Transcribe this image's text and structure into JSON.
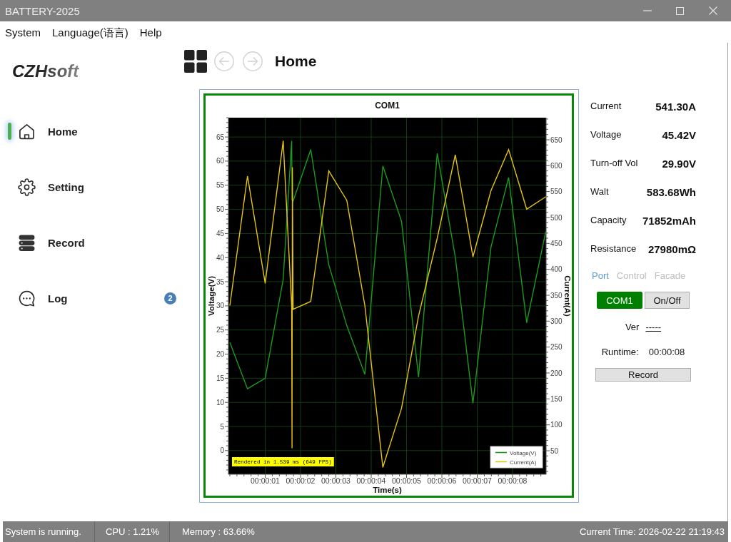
{
  "window": {
    "title": "BATTERY-2025"
  },
  "menu": [
    "System",
    "Language(语言)",
    "Help"
  ],
  "sidebar": {
    "logo": "CZHsoft",
    "items": [
      {
        "label": "Home",
        "selected": true
      },
      {
        "label": "Setting",
        "selected": false
      },
      {
        "label": "Record",
        "selected": false
      },
      {
        "label": "Log",
        "selected": false,
        "badge": "2"
      }
    ]
  },
  "header": {
    "title": "Home"
  },
  "chart_panel": {
    "render_info": "Rendered in 1.539 ms (649 FPS)",
    "chart_data": {
      "type": "line",
      "title": "COM1",
      "xlabel": "Time(s)",
      "ylabel": "Voltage(V)",
      "y2label": "Current(A)",
      "x": [
        0,
        0.5,
        1.0,
        1.51,
        1.75,
        1.76,
        1.77,
        1.79,
        2.29,
        2.8,
        3.31,
        3.82,
        4.33,
        4.86,
        5.34,
        5.87,
        6.38,
        6.88,
        7.39,
        7.89,
        8.4,
        8.94
      ],
      "series": [
        {
          "name": "Voltage(V)",
          "color": "#1c9a1c",
          "values": [
            22.4,
            12.8,
            15.0,
            35.5,
            64.2,
            52.0,
            51.9,
            51.7,
            62.4,
            38.5,
            25.9,
            15.8,
            59.0,
            47.5,
            15.2,
            61.6,
            40.1,
            9.8,
            42.2,
            56.6,
            26.5,
            45.4
          ]
        },
        {
          "name": "Current(A)",
          "color": "#e6c312",
          "axis": "y2",
          "values": [
            330,
            580,
            373,
            648,
            328,
            55,
            597,
            323,
            338,
            590,
            533,
            330,
            18,
            132,
            310,
            460,
            621,
            424,
            552,
            631,
            516,
            540
          ]
        }
      ],
      "xlim": [
        -0.04,
        8.95
      ],
      "ylim": [
        -4.9,
        69
      ],
      "y2lim": [
        4.6,
        692.6
      ],
      "xticks": [
        {
          "value": 1,
          "label": "00:00:01"
        },
        {
          "value": 2,
          "label": "00:00:02"
        },
        {
          "value": 3,
          "label": "00:00:03"
        },
        {
          "value": 4,
          "label": "00:00:04"
        },
        {
          "value": 5,
          "label": "00:00:05"
        },
        {
          "value": 6,
          "label": "00:00:06"
        },
        {
          "value": 7,
          "label": "00:00:07"
        },
        {
          "value": 8,
          "label": "00:00:08"
        }
      ],
      "yticks": [
        0,
        5,
        10,
        15,
        20,
        25,
        30,
        35,
        40,
        45,
        50,
        55,
        60,
        65
      ],
      "y2ticks": [
        50,
        100,
        150,
        200,
        250,
        300,
        350,
        400,
        450,
        500,
        550,
        600,
        650
      ],
      "grid": true,
      "legend": true
    }
  },
  "readings": [
    {
      "label": "Current",
      "value": "541.30A"
    },
    {
      "label": "Voltage",
      "value": "45.42V"
    },
    {
      "label": "Turn-off Vol",
      "value": "29.90V"
    },
    {
      "label": "Walt",
      "value": "583.68Wh"
    },
    {
      "label": "Capacity",
      "value": "71852mAh"
    },
    {
      "label": "Resistance",
      "value": "27980mΩ"
    }
  ],
  "tabs": [
    {
      "label": "Port",
      "selected": true
    },
    {
      "label": "Control",
      "selected": false
    },
    {
      "label": "Facade",
      "selected": false
    }
  ],
  "port_buttons": [
    {
      "label": "COM1",
      "active": true
    },
    {
      "label": "On/Off",
      "active": false
    }
  ],
  "version": {
    "label": "Ver",
    "value": "-----"
  },
  "runtime": {
    "label": "Runtime:",
    "value": "00:00:08"
  },
  "record_button": {
    "label": "Record"
  },
  "status_bar": {
    "message": "System is running.",
    "cpu": "CPU : 1.21%",
    "memory": "Memory : 63.66%",
    "time": "Current Time: 2026-02-22 21:19:43"
  }
}
